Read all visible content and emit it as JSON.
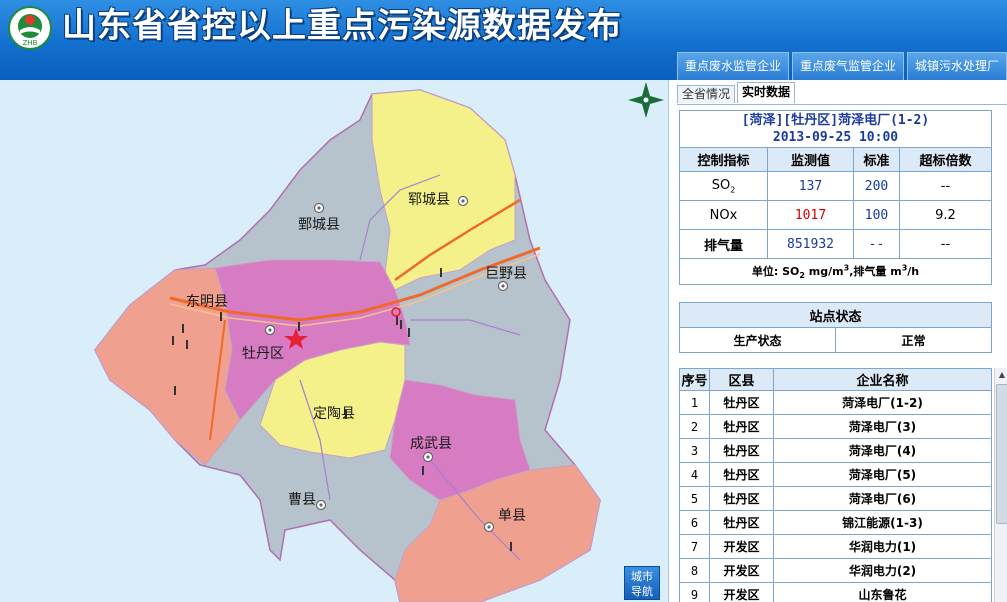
{
  "header": {
    "title": "山东省省控以上重点污染源数据发布",
    "logo_text": "ZHB",
    "nav_tabs": [
      "重点废水监管企业",
      "重点废气监管企业",
      "城镇污水处理厂"
    ]
  },
  "map": {
    "labels": {
      "juancheng": "鄄城县",
      "yuncheng": "郓城县",
      "juye": "巨野县",
      "dongming": "东明县",
      "mudan": "牡丹区",
      "dingtao": "定陶县",
      "chengwu": "成武县",
      "caoxian": "曹县",
      "shanxian": "单县"
    },
    "city_nav_lines": [
      "城市",
      "导航"
    ]
  },
  "panel": {
    "tabs": [
      {
        "label": "全省情况",
        "active": false
      },
      {
        "label": "实时数据",
        "active": true
      }
    ],
    "site": {
      "name": "[菏泽][牡丹区]菏泽电厂(1-2)",
      "datetime": "2013-09-25 10:00"
    },
    "columns": [
      "控制指标",
      "监测值",
      "标准",
      "超标倍数"
    ],
    "rows": {
      "so2": {
        "label_main": "SO",
        "label_sub": "2",
        "value": "137",
        "standard": "200",
        "multiple": "--"
      },
      "nox": {
        "label": "NOx",
        "value": "1017",
        "standard": "100",
        "multiple": "9.2"
      },
      "gas": {
        "label": "排气量",
        "value": "851932",
        "standard": "--",
        "multiple": "--"
      }
    },
    "unit": {
      "prefix": "单位:",
      "so2": "SO",
      "so2_sub": "2",
      "so2_unit": " mg/m",
      "so2_sup": "3",
      "gas": ",排气量 m",
      "gas_sup": "3",
      "gas_tail": "/h"
    },
    "status": {
      "title": "站点状态",
      "label": "生产状态",
      "value": "正常"
    },
    "company_columns": [
      "序号",
      "区县",
      "企业名称"
    ],
    "companies": [
      {
        "no": "1",
        "county": "牡丹区",
        "name": "菏泽电厂(1-2)"
      },
      {
        "no": "2",
        "county": "牡丹区",
        "name": "菏泽电厂(3)"
      },
      {
        "no": "3",
        "county": "牡丹区",
        "name": "菏泽电厂(4)"
      },
      {
        "no": "4",
        "county": "牡丹区",
        "name": "菏泽电厂(5)"
      },
      {
        "no": "5",
        "county": "牡丹区",
        "name": "菏泽电厂(6)"
      },
      {
        "no": "6",
        "county": "牡丹区",
        "name": "锦江能源(1-3)"
      },
      {
        "no": "7",
        "county": "开发区",
        "name": "华润电力(1)"
      },
      {
        "no": "8",
        "county": "开发区",
        "name": "华润电力(2)"
      },
      {
        "no": "9",
        "county": "开发区",
        "name": "山东鲁花"
      }
    ]
  },
  "colors": {
    "header_blue": "#1370cf",
    "region_grey": "#b7c3cc",
    "region_yellow": "#f4f08a",
    "region_pink": "#d77bc2",
    "region_salmon": "#f0a08e",
    "exceed_red": "#d40000",
    "value_blue": "#1a3a9c"
  }
}
